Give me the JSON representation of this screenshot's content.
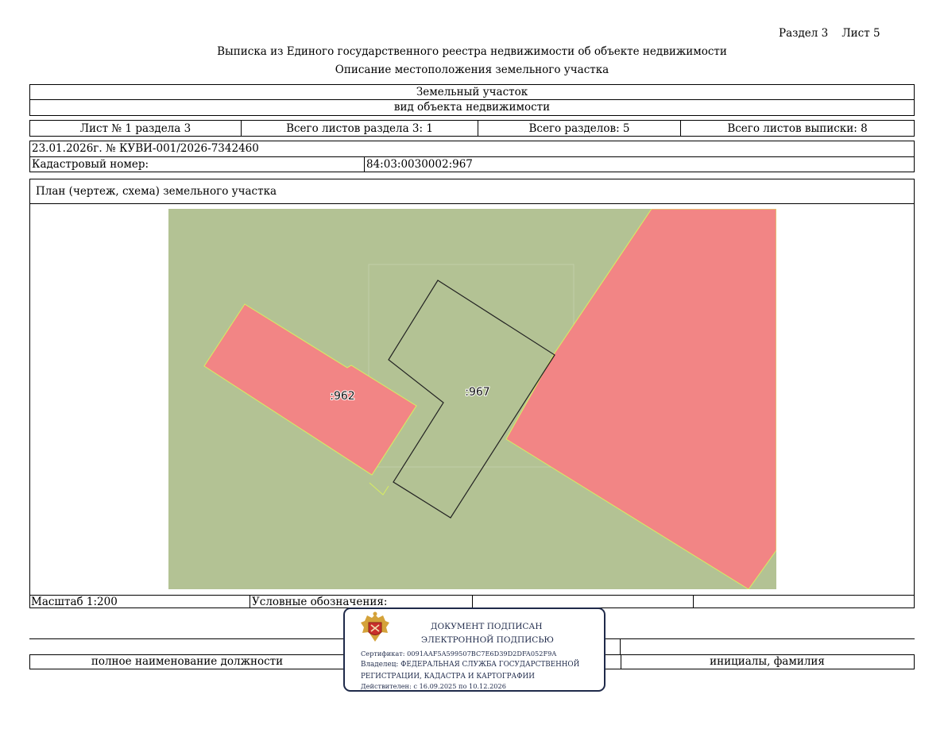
{
  "header": {
    "section_sheet": "Раздел 3    Лист 5",
    "title": "Выписка из Единого государственного реестра недвижимости об объекте недвижимости",
    "subtitle": "Описание местоположения земельного участка"
  },
  "object": {
    "type": "Земельный участок",
    "type_caption": "вид объекта недвижимости"
  },
  "sheet_info": {
    "sheet": "Лист № 1 раздела 3",
    "sheets_in_section": "Всего листов раздела 3: 1",
    "sections_total": "Всего разделов: 5",
    "sheets_total": "Всего листов выписки: 8"
  },
  "record": {
    "date_number": "23.01.2026г. № КУВИ-001/2026-7342460",
    "cadastral_label": "Кадастровый номер:",
    "cadastral_value": "84:03:0030002:967"
  },
  "plan": {
    "title": "План (чертеж, схема) земельного участка",
    "labels": {
      "parcel_962": ":962",
      "parcel_967": ":967"
    },
    "colors": {
      "land": "#b3c294",
      "neighbor": "#f28585",
      "boundary": "#222222",
      "edge": "#d8ee60"
    }
  },
  "legend": {
    "scale": "Масштаб 1:200",
    "symbols_label": "Условные обозначения:"
  },
  "signature": {
    "position_caption": "полное наименование должности",
    "name_caption": "инициалы, фамилия"
  },
  "stamp": {
    "line1": "ДОКУМЕНТ ПОДПИСАН",
    "line2": "ЭЛЕКТРОННОЙ ПОДПИСЬЮ",
    "certificate": "Сертификат: 0091AAF5A599507BC7E6D39D2DFA052F9A",
    "owner1": "Владелец: ФЕДЕРАЛЬНАЯ СЛУЖБА ГОСУДАРСТВЕННОЙ",
    "owner2": "РЕГИСТРАЦИИ, КАДАСТРА И КАРТОГРАФИИ",
    "valid": "Действителен: с 16.09.2025 по 10.12.2026",
    "emblem_color": "#c9302c"
  }
}
